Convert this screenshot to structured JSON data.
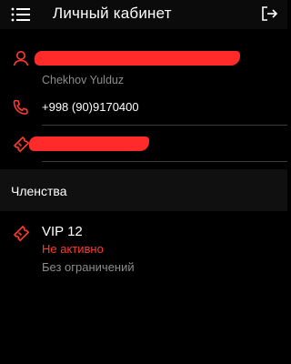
{
  "header": {
    "title": "Личный кабинет",
    "menu_icon": "menu-icon",
    "logout_icon": "logout-icon"
  },
  "profile": {
    "name_sub": "Chekhov Yulduz",
    "phone": "+998 (90)9170400",
    "user_icon": "user-icon",
    "phone_icon": "phone-icon",
    "ticket_icon": "ticket-icon"
  },
  "membership": {
    "section_title": "Членства",
    "plan": "VIP 12",
    "status": "Не активно",
    "limit": "Без ограничений",
    "ticket_icon": "ticket-icon"
  },
  "colors": {
    "accent": "#ff3b30",
    "background": "#000000",
    "muted": "#8c8c8c"
  }
}
